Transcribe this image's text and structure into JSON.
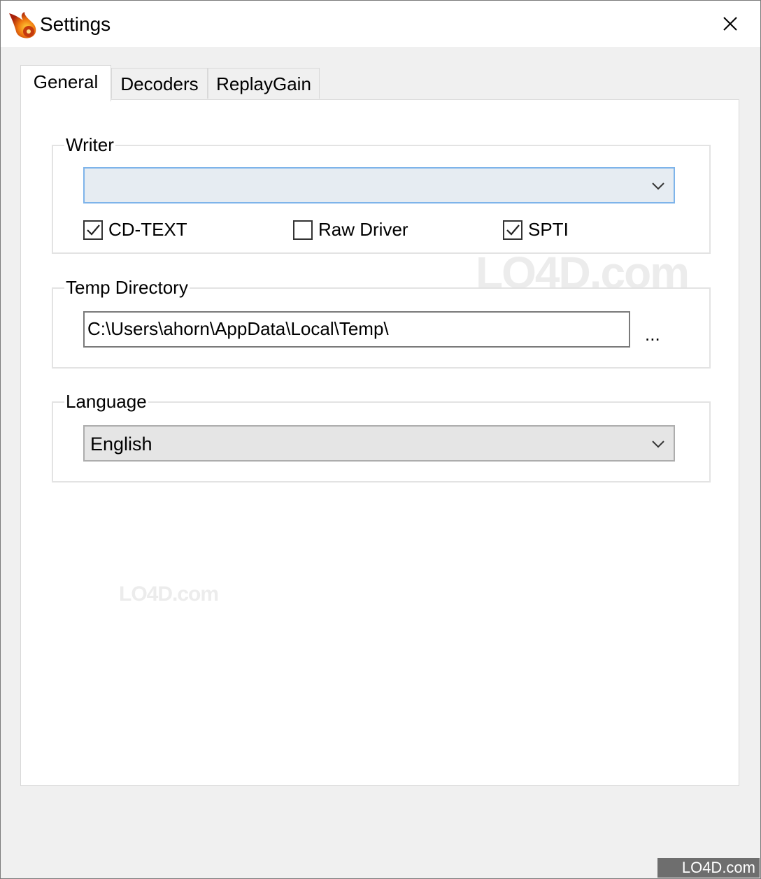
{
  "window": {
    "title": "Settings",
    "close_glyph": "close-icon"
  },
  "tabs": [
    {
      "label": "General",
      "active": true
    },
    {
      "label": "Decoders",
      "active": false
    },
    {
      "label": "ReplayGain",
      "active": false
    }
  ],
  "writer": {
    "group_label": "Writer",
    "selected": "",
    "options": {
      "cd_text": {
        "label": "CD-TEXT",
        "checked": true
      },
      "raw_driver": {
        "label": "Raw Driver",
        "checked": false
      },
      "spti": {
        "label": "SPTI",
        "checked": true
      }
    }
  },
  "temp_directory": {
    "group_label": "Temp Directory",
    "value": "C:\\Users\\ahorn\\AppData\\Local\\Temp\\",
    "browse_label": "..."
  },
  "language": {
    "group_label": "Language",
    "selected": "English"
  },
  "watermark": {
    "text": "LO4D.com"
  },
  "colors": {
    "accent_border": "#7eb4ea",
    "window_bg": "#f0f0f0",
    "panel_bg": "#ffffff"
  }
}
